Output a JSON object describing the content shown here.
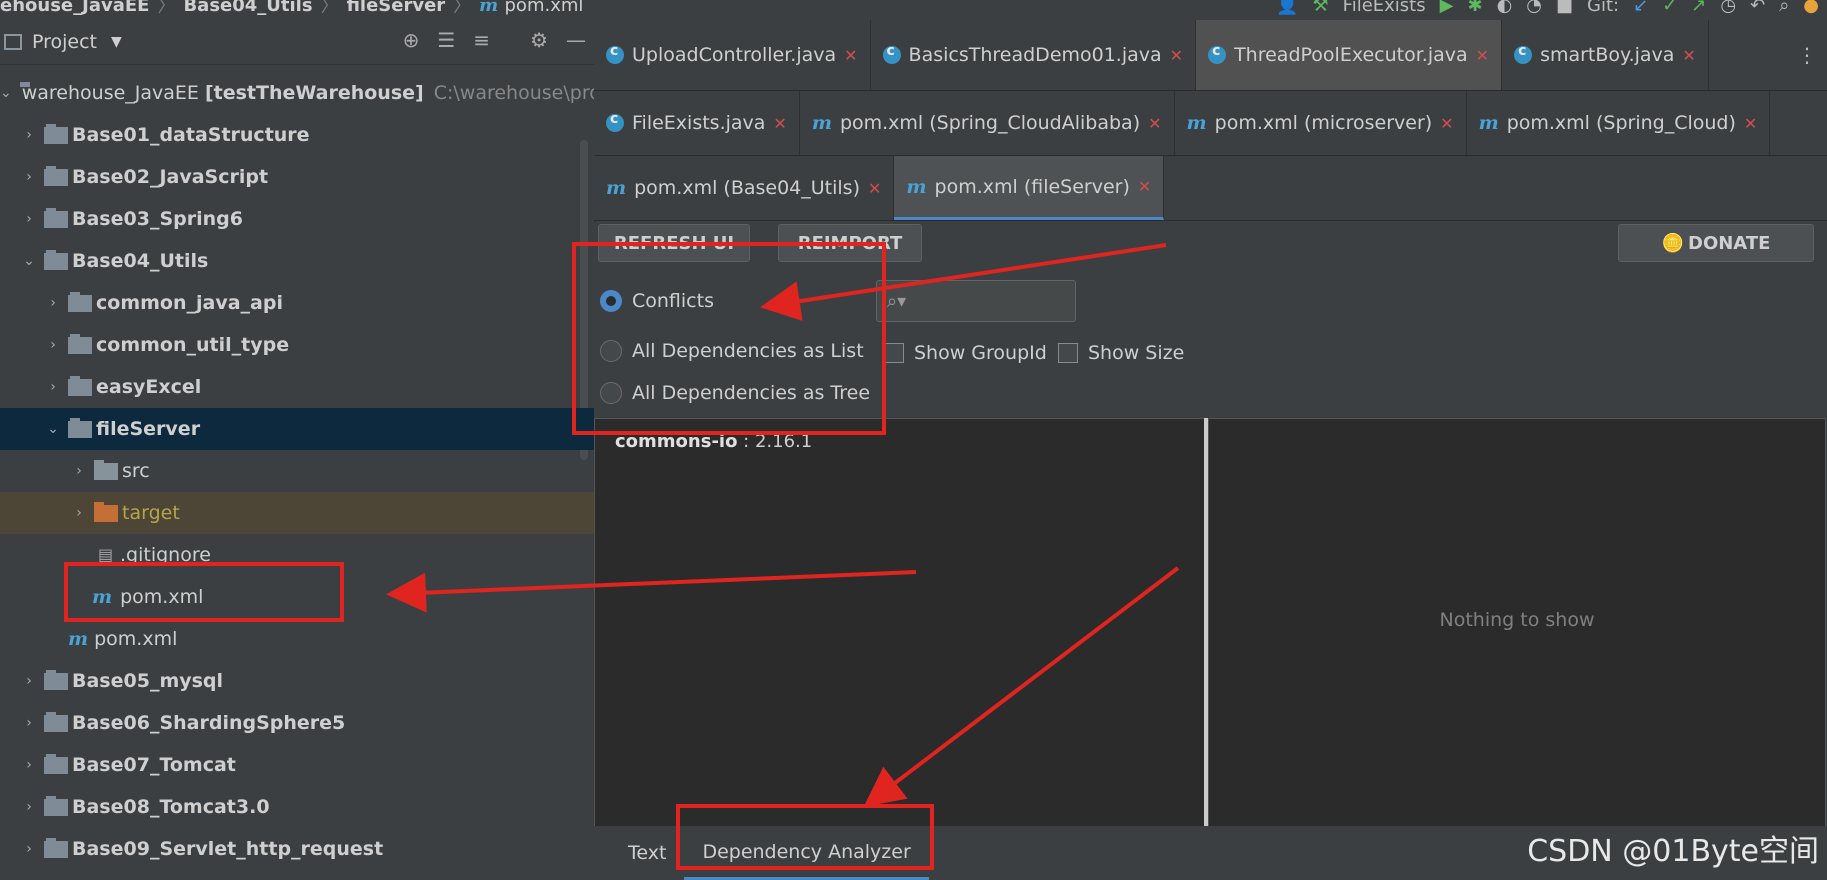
{
  "breadcrumb": [
    "ehouse_JavaEE",
    "Base04_Utils",
    "fileServer",
    "pom.xml"
  ],
  "toolbar": {
    "run_config": "FileExists",
    "git_label": "Git:"
  },
  "project": {
    "title": "Project",
    "tree": [
      {
        "label": "warehouse_JavaEE",
        "extra": "[testTheWarehouse]",
        "path": "C:\\warehouse\\project\\w"
      },
      {
        "label": "Base01_dataStructure"
      },
      {
        "label": "Base02_JavaScript"
      },
      {
        "label": "Base03_Spring6"
      },
      {
        "label": "Base04_Utils"
      },
      {
        "label": "common_java_api"
      },
      {
        "label": "common_util_type"
      },
      {
        "label": "easyExcel"
      },
      {
        "label": "fileServer"
      },
      {
        "label": "src"
      },
      {
        "label": "target"
      },
      {
        "label": ".gitignore"
      },
      {
        "label": "pom.xml"
      },
      {
        "label": "pom.xml"
      },
      {
        "label": "Base05_mysql"
      },
      {
        "label": "Base06_ShardingSphere5"
      },
      {
        "label": "Base07_Tomcat"
      },
      {
        "label": "Base08_Tomcat3.0"
      },
      {
        "label": "Base09_Servlet_http_request"
      }
    ]
  },
  "tabs_row1": [
    "UploadController.java",
    "BasicsThreadDemo01.java",
    "ThreadPoolExecutor.java",
    "smartBoy.java"
  ],
  "tabs_row2": [
    "FileExists.java",
    "pom.xml (Spring_CloudAlibaba)",
    "pom.xml (microserver)",
    "pom.xml (Spring_Cloud)"
  ],
  "tabs_row3": [
    "pom.xml (Base04_Utils)",
    "pom.xml (fileServer)"
  ],
  "analyzer": {
    "refresh_label": "REFRESH UI",
    "reimport_label": "REIMPORT",
    "donate_label": "DONATE",
    "radio_conflicts": "Conflicts",
    "radio_list": "All Dependencies as List",
    "radio_tree": "All Dependencies as Tree",
    "show_groupid": "Show GroupId",
    "show_size": "Show Size",
    "dep_name": "commons-io",
    "dep_version": " : 2.16.1",
    "nothing_to_show": "Nothing to show",
    "bottom_tab_text": "Text",
    "bottom_tab_analyzer": "Dependency Analyzer"
  },
  "watermark": "CSDN @01Byte空间",
  "annotation_color": "#e0241f"
}
